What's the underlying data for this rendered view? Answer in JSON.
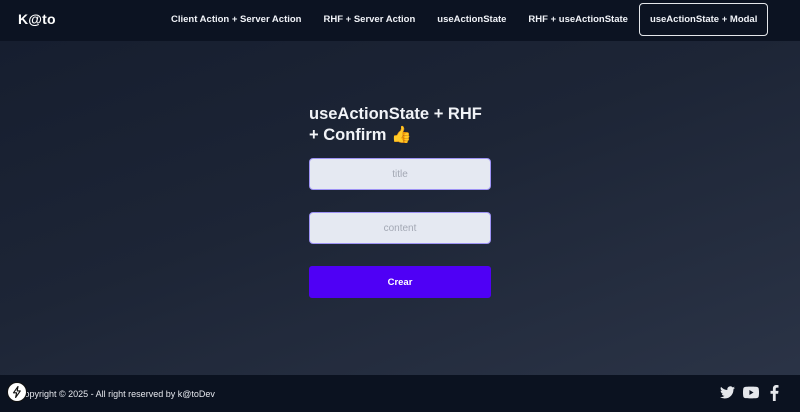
{
  "navbar": {
    "brand": "K@to",
    "links": [
      {
        "label": "Client Action + Server Action"
      },
      {
        "label": "RHF + Server Action"
      },
      {
        "label": "useActionState"
      },
      {
        "label": "RHF + useActionState"
      },
      {
        "label": "useActionState + Modal",
        "active": true
      }
    ]
  },
  "form": {
    "title": "useActionState + RHF + Confirm 👍",
    "title_placeholder": "title",
    "content_placeholder": "content",
    "submit_label": "Crear"
  },
  "footer": {
    "copyright": "Copyright © 2025 - All right reserved by k@toDev",
    "social_icons": [
      "twitter-icon",
      "youtube-icon",
      "facebook-icon"
    ]
  },
  "colors": {
    "accent_button": "#4f00f5",
    "navbar_bg": "#0c1322",
    "input_border": "#9e93f5"
  },
  "floating_badge_icon": "bolt-icon"
}
